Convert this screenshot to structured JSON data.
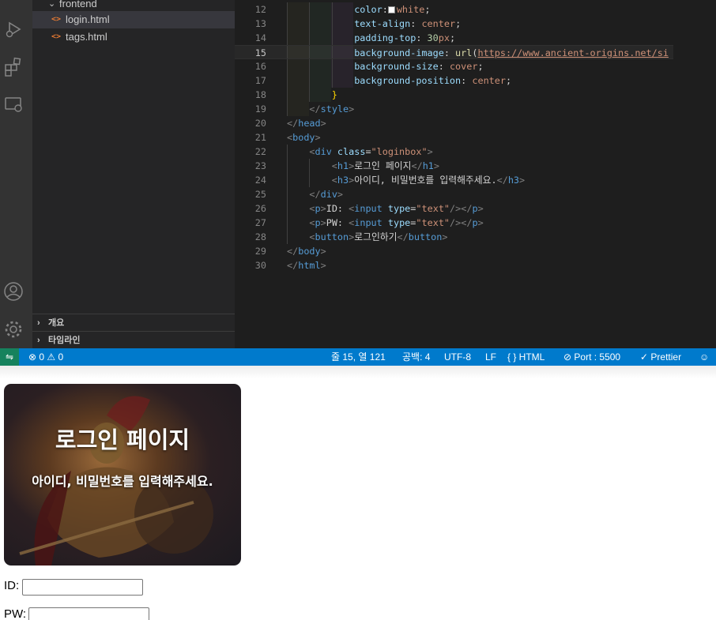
{
  "explorer": {
    "folder": "frontend",
    "files": [
      "login.html",
      "tags.html"
    ],
    "panels": [
      "개요",
      "타임라인"
    ]
  },
  "editor": {
    "current_line": 15,
    "lines": [
      {
        "n": "12",
        "tokens": [
          [
            "c-prop",
            "color"
          ],
          [
            "",
            "："
          ],
          [
            "swatch",
            ""
          ],
          [
            "c-val",
            "white"
          ],
          [
            "",
            ";"
          ]
        ]
      },
      {
        "n": "13",
        "tokens": [
          [
            "c-prop",
            "text-align"
          ],
          [
            "",
            ": "
          ],
          [
            "c-val",
            "center"
          ],
          [
            "",
            ";"
          ]
        ]
      },
      {
        "n": "14",
        "tokens": [
          [
            "c-prop",
            "padding-top"
          ],
          [
            "",
            ": "
          ],
          [
            "c-num",
            "30"
          ],
          [
            "c-val",
            "px"
          ],
          [
            "",
            ";"
          ]
        ]
      },
      {
        "n": "15",
        "tokens": [
          [
            "c-prop",
            "background-image"
          ],
          [
            "",
            ": "
          ],
          [
            "c-fn",
            "url"
          ],
          [
            "",
            "("
          ],
          [
            "c-url",
            "https://www.ancient-origins.net/si"
          ]
        ]
      },
      {
        "n": "16",
        "tokens": [
          [
            "c-prop",
            "background-size"
          ],
          [
            "",
            ": "
          ],
          [
            "c-val",
            "cover"
          ],
          [
            "",
            ";"
          ]
        ]
      },
      {
        "n": "17",
        "tokens": [
          [
            "c-prop",
            "background-position"
          ],
          [
            "",
            ": "
          ],
          [
            "c-val",
            "center"
          ],
          [
            "",
            ";"
          ]
        ]
      },
      {
        "n": "18",
        "tokens": [
          [
            "c-brace",
            "}"
          ]
        ]
      },
      {
        "n": "19",
        "tokens": [
          [
            "c-br",
            "</"
          ],
          [
            "c-tag",
            "style"
          ],
          [
            "c-br",
            ">"
          ]
        ]
      },
      {
        "n": "20",
        "tokens": [
          [
            "c-br",
            "</"
          ],
          [
            "c-tag",
            "head"
          ],
          [
            "c-br",
            ">"
          ]
        ]
      },
      {
        "n": "21",
        "tokens": [
          [
            "c-br",
            "<"
          ],
          [
            "c-tag",
            "body"
          ],
          [
            "c-br",
            ">"
          ]
        ]
      },
      {
        "n": "22",
        "tokens": [
          [
            "c-br",
            "<"
          ],
          [
            "c-tag",
            "div"
          ],
          [
            "",
            " "
          ],
          [
            "c-prop",
            "class"
          ],
          [
            "",
            "="
          ],
          [
            "c-str",
            "\"loginbox\""
          ],
          [
            "c-br",
            ">"
          ]
        ]
      },
      {
        "n": "23",
        "tokens": [
          [
            "c-br",
            "<"
          ],
          [
            "c-tag",
            "h1"
          ],
          [
            "c-br",
            ">"
          ],
          [
            "",
            "로그인 페이지"
          ],
          [
            "c-br",
            "</"
          ],
          [
            "c-tag",
            "h1"
          ],
          [
            "c-br",
            ">"
          ]
        ]
      },
      {
        "n": "24",
        "tokens": [
          [
            "c-br",
            "<"
          ],
          [
            "c-tag",
            "h3"
          ],
          [
            "c-br",
            ">"
          ],
          [
            "",
            "아이디, 비밀번호를 입력해주세요."
          ],
          [
            "c-br",
            "</"
          ],
          [
            "c-tag",
            "h3"
          ],
          [
            "c-br",
            ">"
          ]
        ]
      },
      {
        "n": "25",
        "tokens": [
          [
            "c-br",
            "</"
          ],
          [
            "c-tag",
            "div"
          ],
          [
            "c-br",
            ">"
          ]
        ]
      },
      {
        "n": "26",
        "tokens": [
          [
            "c-br",
            "<"
          ],
          [
            "c-tag",
            "p"
          ],
          [
            "c-br",
            ">"
          ],
          [
            "",
            "ID: "
          ],
          [
            "c-br",
            "<"
          ],
          [
            "c-tag",
            "input"
          ],
          [
            "",
            " "
          ],
          [
            "c-prop",
            "type"
          ],
          [
            "",
            "="
          ],
          [
            "c-str",
            "\"text\""
          ],
          [
            "c-br",
            "/></"
          ],
          [
            "c-tag",
            "p"
          ],
          [
            "c-br",
            ">"
          ]
        ]
      },
      {
        "n": "27",
        "tokens": [
          [
            "c-br",
            "<"
          ],
          [
            "c-tag",
            "p"
          ],
          [
            "c-br",
            ">"
          ],
          [
            "",
            "PW: "
          ],
          [
            "c-br",
            "<"
          ],
          [
            "c-tag",
            "input"
          ],
          [
            "",
            " "
          ],
          [
            "c-prop",
            "type"
          ],
          [
            "",
            "="
          ],
          [
            "c-str",
            "\"text\""
          ],
          [
            "c-br",
            "/></"
          ],
          [
            "c-tag",
            "p"
          ],
          [
            "c-br",
            ">"
          ]
        ]
      },
      {
        "n": "28",
        "tokens": [
          [
            "c-br",
            "<"
          ],
          [
            "c-tag",
            "button"
          ],
          [
            "c-br",
            ">"
          ],
          [
            "",
            "로그인하기"
          ],
          [
            "c-br",
            "</"
          ],
          [
            "c-tag",
            "button"
          ],
          [
            "c-br",
            ">"
          ]
        ]
      },
      {
        "n": "29",
        "tokens": [
          [
            "c-br",
            "</"
          ],
          [
            "c-tag",
            "body"
          ],
          [
            "c-br",
            ">"
          ]
        ]
      },
      {
        "n": "30",
        "tokens": [
          [
            "c-br",
            "</"
          ],
          [
            "c-tag",
            "html"
          ],
          [
            "c-br",
            ">"
          ]
        ]
      }
    ]
  },
  "statusbar": {
    "problems": "⊗ 0 ⚠ 0",
    "cursor": "줄 15, 열 121",
    "spaces": "공백: 4",
    "encoding": "UTF-8",
    "eol": "LF",
    "language": "{ } HTML",
    "port": "⊘ Port : 5500",
    "prettier": "✓ Prettier"
  },
  "preview": {
    "h1": "로그인 페이지",
    "h3": "아이디, 비밀번호를 입력해주세요.",
    "id_label": "ID:",
    "pw_label": "PW:"
  },
  "colors": {
    "statusbar": "#007acc",
    "remote": "#16825d",
    "editor_bg": "#1e1e1e",
    "sidebar_bg": "#252526",
    "activity_bg": "#333333"
  }
}
